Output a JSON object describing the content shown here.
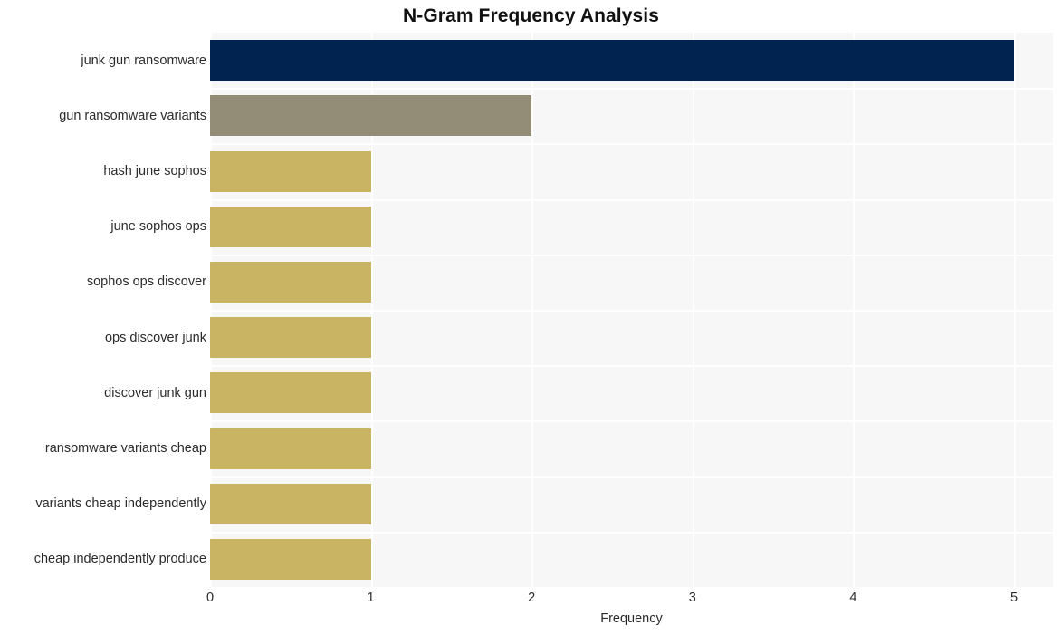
{
  "chart_data": {
    "type": "bar",
    "orientation": "horizontal",
    "title": "N-Gram Frequency Analysis",
    "xlabel": "Frequency",
    "ylabel": "",
    "categories": [
      "junk gun ransomware",
      "gun ransomware variants",
      "hash june sophos",
      "june sophos ops",
      "sophos ops discover",
      "ops discover junk",
      "discover junk gun",
      "ransomware variants cheap",
      "variants cheap independently",
      "cheap independently produce"
    ],
    "values": [
      5,
      2,
      1,
      1,
      1,
      1,
      1,
      1,
      1,
      1
    ],
    "bar_colors": [
      "#002350",
      "#938c77",
      "#c8b463",
      "#c8b463",
      "#c8b463",
      "#c8b463",
      "#c8b463",
      "#c8b463",
      "#c8b463",
      "#c8b463"
    ],
    "xlim": [
      0,
      5
    ],
    "xticks": [
      0,
      1,
      2,
      3,
      4,
      5
    ],
    "xtick_labels": [
      "0",
      "1",
      "2",
      "3",
      "4",
      "5"
    ],
    "grid": true,
    "grid_color": "#ffffff",
    "plot_background": "#f7f7f7",
    "figure_background": "#ffffff",
    "legend": null
  }
}
